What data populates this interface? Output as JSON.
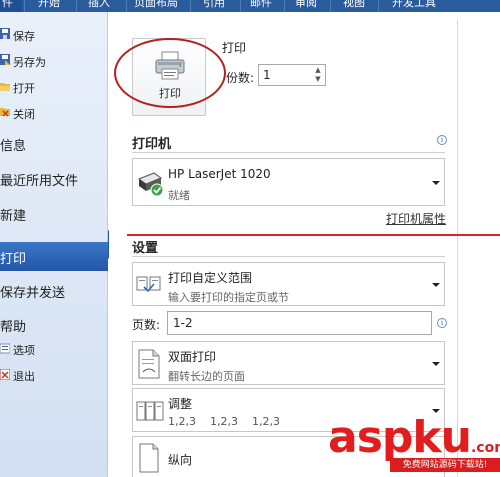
{
  "ribbon": {
    "tabs": [
      {
        "label": "件"
      },
      {
        "label": "开始"
      },
      {
        "label": "插入"
      },
      {
        "label": "页面布局"
      },
      {
        "label": "引用"
      },
      {
        "label": "邮件"
      },
      {
        "label": "审阅"
      },
      {
        "label": "视图"
      },
      {
        "label": "开发工具"
      }
    ],
    "accent": "#2a5b9c"
  },
  "sidebar": {
    "items": [
      {
        "label": "保存",
        "icon": "save-icon"
      },
      {
        "label": "另存为",
        "icon": "save-as-icon"
      },
      {
        "label": "打开",
        "icon": "open-folder-icon"
      },
      {
        "label": "关闭",
        "icon": "close-doc-icon"
      },
      {
        "label": "信息"
      },
      {
        "label": "最近所用文件"
      },
      {
        "label": "新建"
      },
      {
        "label": "打印",
        "active": true
      },
      {
        "label": "保存并发送"
      },
      {
        "label": "帮助"
      },
      {
        "label": "选项",
        "icon": "options-icon"
      },
      {
        "label": "退出",
        "icon": "exit-icon"
      }
    ],
    "active_color": "#2456a6"
  },
  "print": {
    "title": "打印",
    "button_label": "打印",
    "copies_label": "份数:",
    "copies_value": "1"
  },
  "printer": {
    "section_title": "打印机",
    "name": "HP LaserJet 1020",
    "status": "就绪",
    "properties_link": "打印机属性"
  },
  "settings": {
    "section_title": "设置",
    "range": {
      "title": "打印自定义范围",
      "subtitle": "输入要打印的指定页或节"
    },
    "pages_label": "页数:",
    "pages_value": "1-2",
    "duplex": {
      "title": "双面打印",
      "subtitle": "翻转长边的页面"
    },
    "collate": {
      "title": "调整",
      "subtitle": "1,2,3    1,2,3    1,2,3"
    },
    "orientation": {
      "title": "纵向"
    }
  },
  "watermark": {
    "text": "aspku",
    "tld": ".com",
    "subtext": "免费网站源码下载站!"
  },
  "annotation_color": "#b3211e"
}
